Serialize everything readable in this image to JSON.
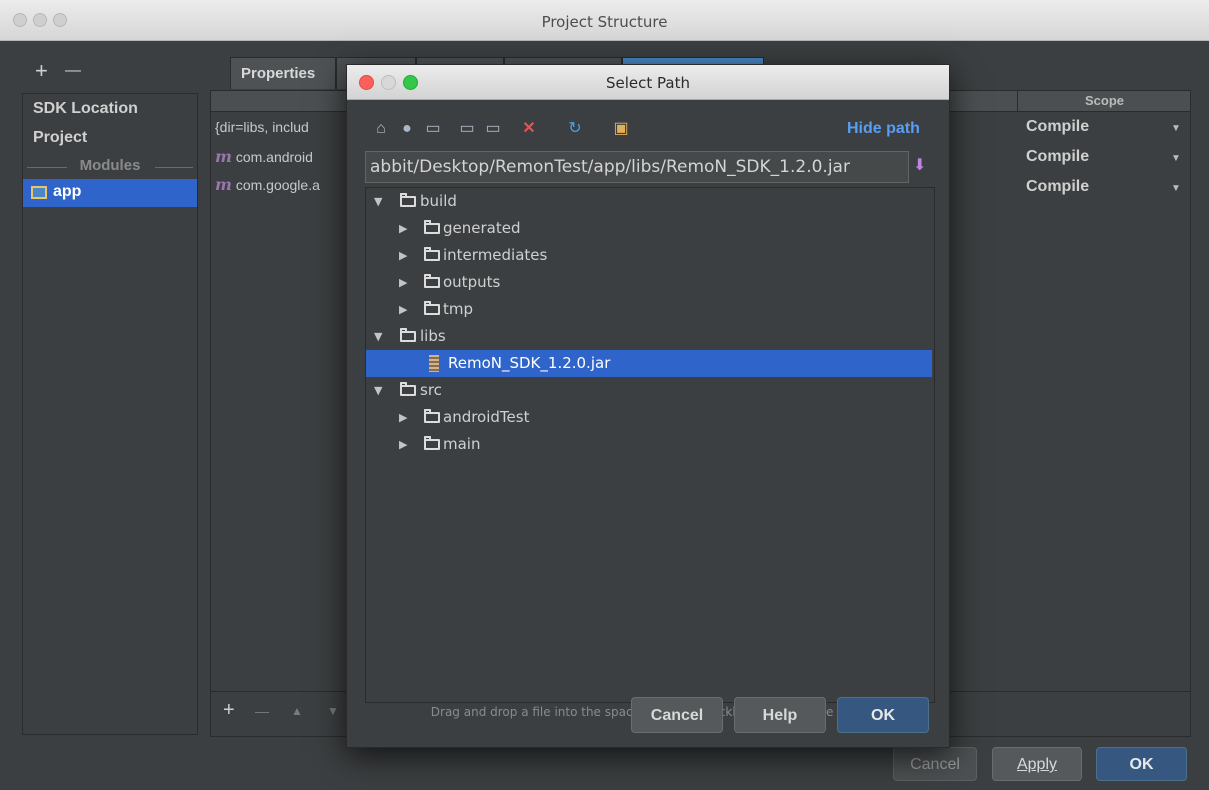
{
  "window": {
    "title": "Project Structure"
  },
  "left": {
    "add_label": "+",
    "remove_label": "—",
    "items": [
      {
        "label": "SDK Location"
      },
      {
        "label": "Project"
      }
    ],
    "modules_label": "Modules",
    "selected_module": "app"
  },
  "tabs": [
    {
      "label": "Properties"
    }
  ],
  "dependencies": {
    "scope_header": "Scope",
    "rows": [
      {
        "text": "{dir=libs, includ",
        "scope": "Compile"
      },
      {
        "icon": "m",
        "text": "com.android",
        "scope": "Compile"
      },
      {
        "icon": "m",
        "text": "com.google.a",
        "scope": "Compile"
      }
    ],
    "toolbar": {
      "add": "+",
      "remove": "—",
      "up": "▲",
      "down": "▼"
    }
  },
  "footer": {
    "cancel": "Cancel",
    "apply": "Apply",
    "ok": "OK"
  },
  "dialog": {
    "title": "Select Path",
    "hide_path": "Hide path",
    "path_value": "abbit/Desktop/RemonTest/app/libs/RemoN_SDK_1.2.0.jar",
    "toolbar_icons": [
      "home-icon",
      "android-icon",
      "module-icon",
      "new-folder-icon",
      "delete-icon",
      "refresh-icon",
      "show-hidden-icon"
    ],
    "tree": [
      {
        "label": "build",
        "depth": 0,
        "expanded": true
      },
      {
        "label": "generated",
        "depth": 1,
        "expanded": false
      },
      {
        "label": "intermediates",
        "depth": 1,
        "expanded": false
      },
      {
        "label": "outputs",
        "depth": 1,
        "expanded": false
      },
      {
        "label": "tmp",
        "depth": 1,
        "expanded": false
      },
      {
        "label": "libs",
        "depth": 0,
        "expanded": true
      },
      {
        "label": "RemoN_SDK_1.2.0.jar",
        "depth": 1,
        "selected": true
      },
      {
        "label": "src",
        "depth": 0,
        "expanded": true
      },
      {
        "label": "androidTest",
        "depth": 1,
        "expanded": false
      },
      {
        "label": "main",
        "depth": 1,
        "expanded": false
      }
    ],
    "hint": "Drag and drop a file into the space above to quickly locate it in the tree.",
    "buttons": {
      "cancel": "Cancel",
      "help": "Help",
      "ok": "OK"
    }
  }
}
